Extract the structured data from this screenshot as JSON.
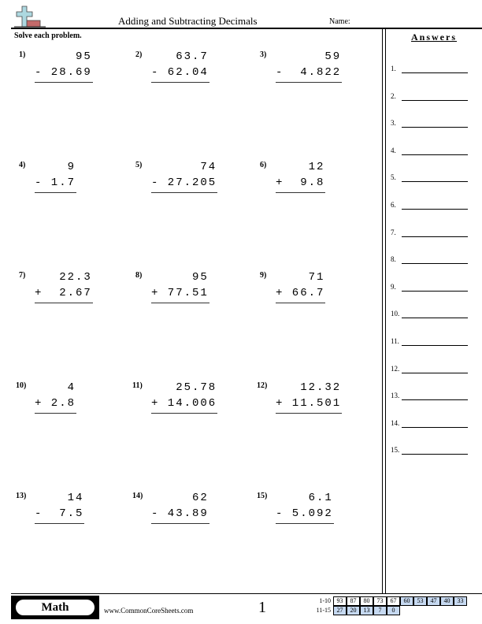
{
  "header": {
    "title": "Adding and Subtracting Decimals",
    "name_label": "Name:",
    "logo_icon": "plus-eraser-logo-icon"
  },
  "instructions": "Solve each problem.",
  "problems": [
    {
      "label": "1)",
      "top": "95",
      "bottom": "- 28.69"
    },
    {
      "label": "2)",
      "top": "63.7",
      "bottom": "- 62.04"
    },
    {
      "label": "3)",
      "top": "59",
      "bottom": "-  4.822"
    },
    {
      "label": "4)",
      "top": "9",
      "bottom": "- 1.7"
    },
    {
      "label": "5)",
      "top": "74",
      "bottom": "- 27.205"
    },
    {
      "label": "6)",
      "top": "12",
      "bottom": "+  9.8"
    },
    {
      "label": "7)",
      "top": "22.3",
      "bottom": "+  2.67"
    },
    {
      "label": "8)",
      "top": "95",
      "bottom": "+ 77.51"
    },
    {
      "label": "9)",
      "top": "71",
      "bottom": "+ 66.7"
    },
    {
      "label": "10)",
      "top": "4",
      "bottom": "+ 2.8"
    },
    {
      "label": "11)",
      "top": "25.78",
      "bottom": "+ 14.006"
    },
    {
      "label": "12)",
      "top": "12.32",
      "bottom": "+ 11.501"
    },
    {
      "label": "13)",
      "top": "14",
      "bottom": "-  7.5"
    },
    {
      "label": "14)",
      "top": "62",
      "bottom": "- 43.89"
    },
    {
      "label": "15)",
      "top": "6.1",
      "bottom": "- 5.092"
    }
  ],
  "answers": {
    "title": "Answers",
    "labels": [
      "1.",
      "2.",
      "3.",
      "4.",
      "5.",
      "6.",
      "7.",
      "8.",
      "9.",
      "10.",
      "11.",
      "12.",
      "13.",
      "14.",
      "15."
    ]
  },
  "footer": {
    "subject": "Math",
    "website": "www.CommonCoreSheets.com",
    "page_number": "1",
    "score_rows": [
      {
        "label": "1-10",
        "cells": [
          "93",
          "87",
          "80",
          "73",
          "67",
          "60",
          "53",
          "47",
          "40",
          "33"
        ]
      },
      {
        "label": "11-15",
        "cells": [
          "27",
          "20",
          "13",
          "7",
          "0"
        ]
      }
    ]
  }
}
